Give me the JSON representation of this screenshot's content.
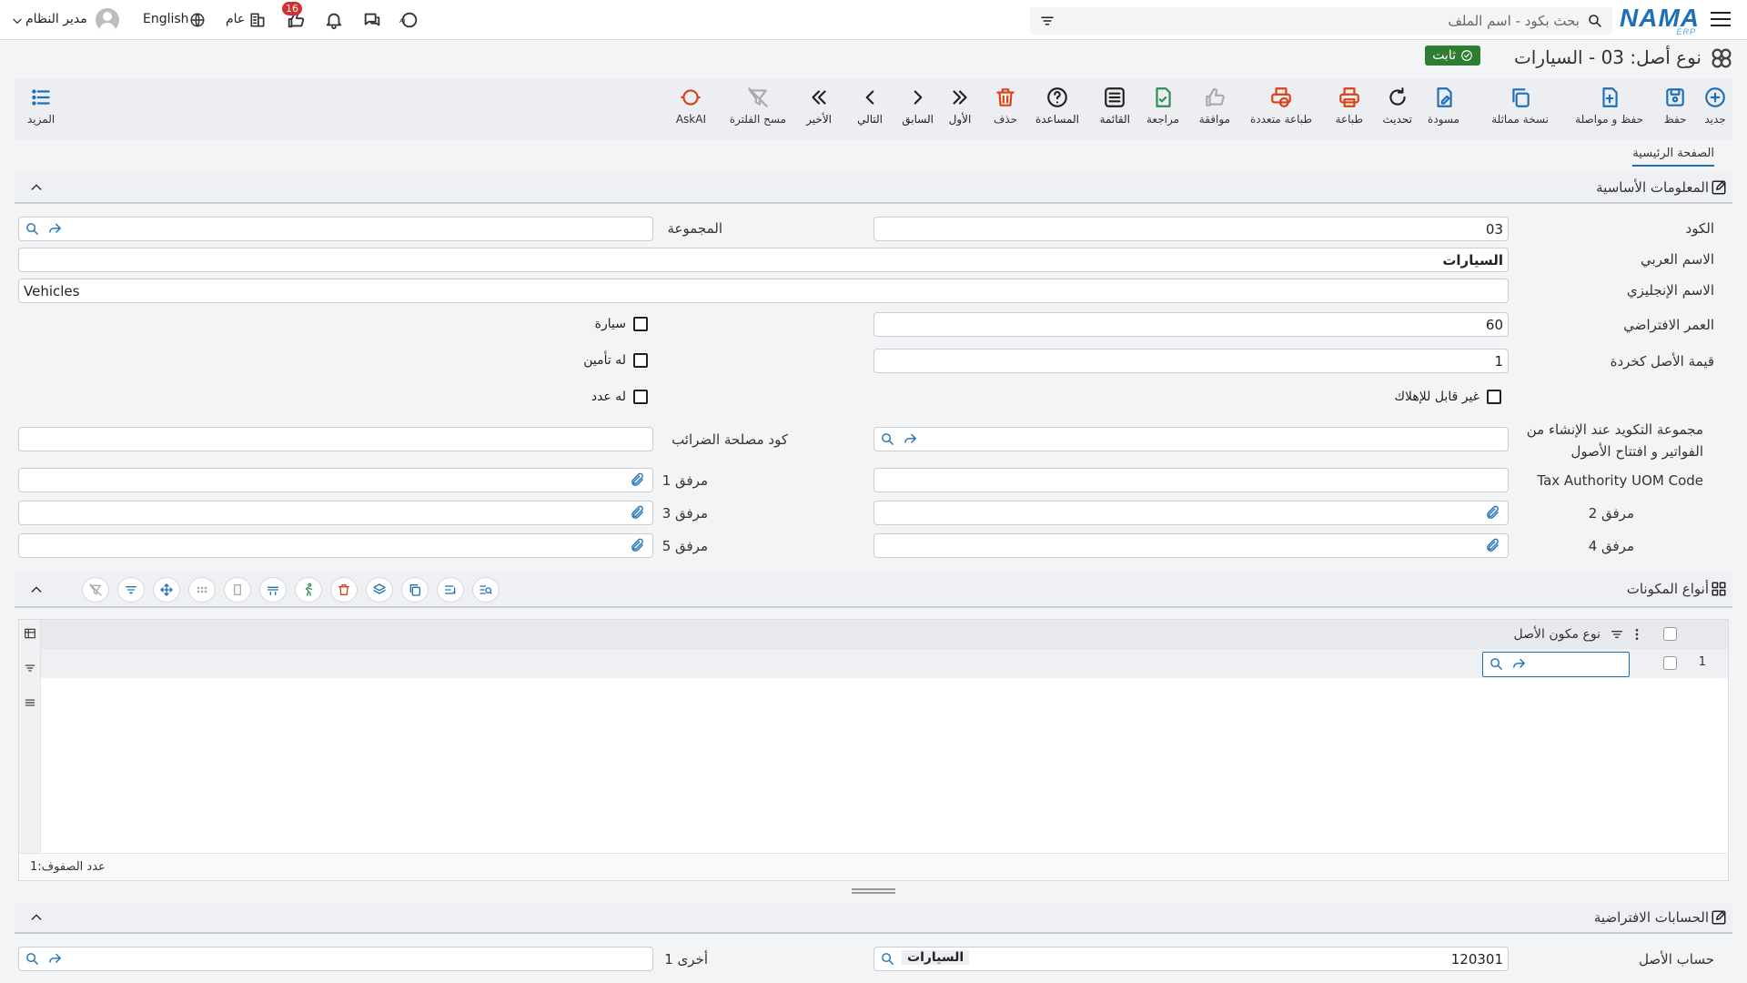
{
  "topbar": {
    "logo": "NAMA",
    "logo_sub": "ERP",
    "search_placeholder": "بحث بكود - اسم الملف",
    "notif_count": "16",
    "scope_label": "عام",
    "language_label": "English",
    "user_name": "مدير النظام"
  },
  "title": {
    "text": "نوع أصل: 03 - السيارات",
    "status": "ثابت"
  },
  "toolbar": {
    "new": "جديد",
    "save": "حفظ",
    "save_continue": "حفظ و مواصلة",
    "duplicate": "نسخة مماثلة",
    "draft": "مسودة",
    "refresh": "تحديث",
    "print": "طباعة",
    "multi_print": "طباعة متعددة",
    "approve": "موافقة",
    "review": "مراجعة",
    "list": "القائمة",
    "help": "المساعدة",
    "delete": "حذف",
    "first": "الأول",
    "previous": "السابق",
    "next": "التالي",
    "last": "الأخير",
    "clear_filter": "مسح الفلترة",
    "askai": "AskAI",
    "more": "المزيد"
  },
  "tabs": {
    "main": "الصفحة الرئيسية"
  },
  "basic_info": {
    "title": "المعلومات الأساسية",
    "code_label": "الكود",
    "code_value": "03",
    "group_label": "المجموعة",
    "arabic_name_label": "الاسم العربي",
    "arabic_name_value": "السيارات",
    "english_name_label": "الاسم الإنجليزي",
    "english_name_value": "Vehicles",
    "default_age_label": "العمر الافتراضي",
    "default_age_value": "60",
    "scrap_value_label": "قيمة الأصل كخردة",
    "scrap_value_value": "1",
    "car_label": "سيارة",
    "has_insurance_label": "له تأمين",
    "has_meter_label": "له عدد",
    "non_depreciable_label": "غير قابل للإهلاك",
    "confirm_group_label_1": "مجموعة التكويد عند الإنشاء من",
    "confirm_group_label_2": "الفواتير و افتتاح الأصول",
    "tax_code_label": "كود مصلحة الضرائب",
    "tax_uom_label": "Tax Authority UOM Code",
    "attachment1_label": "مرفق 1",
    "attachment2_label": "مرفق 2",
    "attachment3_label": "مرفق 3",
    "attachment4_label": "مرفق 4",
    "attachment5_label": "مرفق 5"
  },
  "components": {
    "title": "أنواع المكونات",
    "column_title": "نوع مكون الأصل",
    "row_number": "1",
    "rows_count_label": "عدد الصفوف:",
    "rows_count_value": "1"
  },
  "default_accounts": {
    "title": "الحسابات الافتراضية",
    "asset_account_label": "حساب الأصل",
    "asset_account_code": "120301",
    "asset_account_name": "السيارات",
    "other1_label": "أخرى 1"
  }
}
